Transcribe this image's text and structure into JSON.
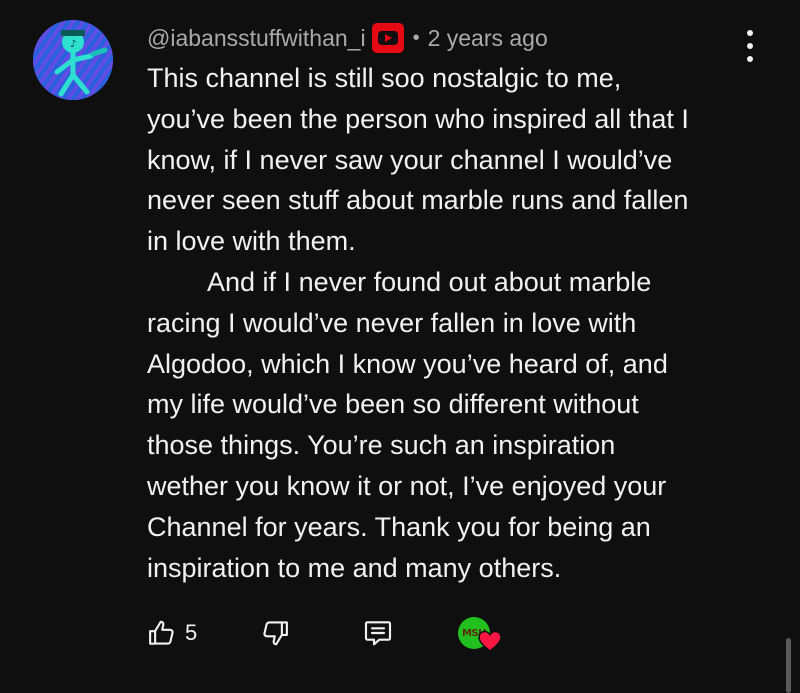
{
  "comment": {
    "author": "@iabansstuffwithan_i",
    "separator": "•",
    "timestamp": "2 years ago",
    "badge_icon": "youtube-play-icon",
    "avatar_icon": "music-figure-avatar",
    "body": "This channel is still soo nostalgic to me,\nyou’ve been the person who inspired all that I\nknow, if I never saw your channel I would’ve\nnever seen stuff about marble runs and fallen\nin love with them.\n        And if I never found out about marble\nracing I would’ve never fallen in love with\nAlgodoo, which I know you’ve heard of, and\nmy life would’ve been so different without\nthose things. You’re such an inspiration\nwether you know it or not, I’ve enjoyed your\nChannel for years. Thank you for being an\ninspiration to me and many others.",
    "like_count": "5",
    "creator_heart_label": "MSH"
  },
  "colors": {
    "background": "#0f0f0f",
    "text": "#f1f1f1",
    "secondary_text": "#aaaaaa",
    "badge_red": "#e50914",
    "heart_red": "#ff1744",
    "creator_green": "#22c01e"
  }
}
